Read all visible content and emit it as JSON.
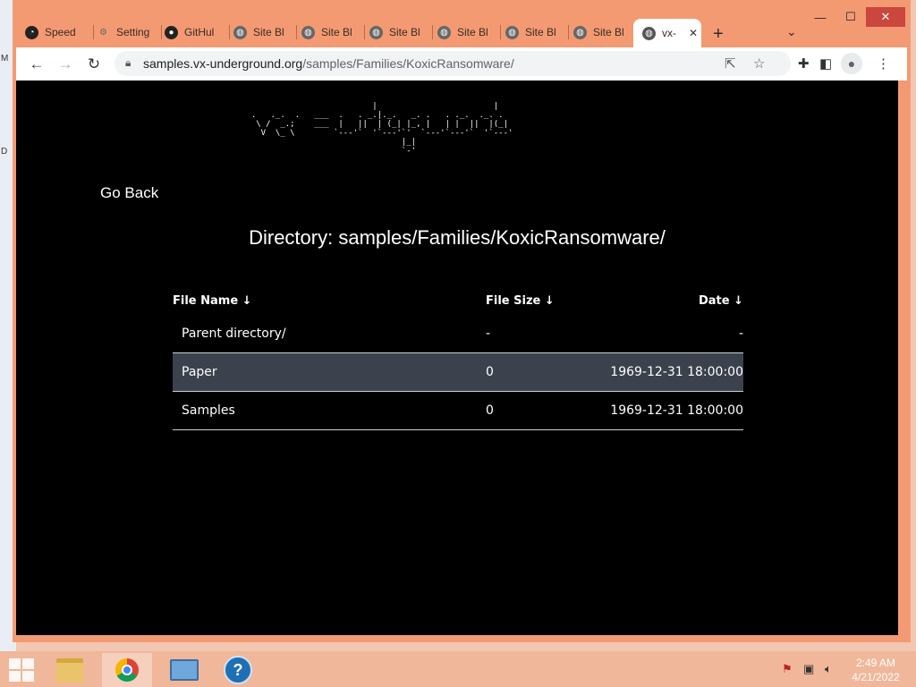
{
  "desktop": {
    "letter_top": "M",
    "letter_mid": "D"
  },
  "window_controls": {
    "minimize": "—",
    "maximize": "☐",
    "close": "✕"
  },
  "tabs": [
    {
      "label": "Speed",
      "icon": "speedometer-icon"
    },
    {
      "label": "Setting",
      "icon": "gear-icon"
    },
    {
      "label": "GitHul",
      "icon": "github-icon"
    },
    {
      "label": "Site Bl",
      "icon": "globe-icon"
    },
    {
      "label": "Site Bl",
      "icon": "globe-icon"
    },
    {
      "label": "Site Bl",
      "icon": "globe-icon"
    },
    {
      "label": "Site Bl",
      "icon": "globe-icon"
    },
    {
      "label": "Site Bl",
      "icon": "globe-icon"
    },
    {
      "label": "Site Bl",
      "icon": "globe-icon"
    },
    {
      "label": "vx-",
      "icon": "globe-icon",
      "active": true
    }
  ],
  "tab_close": "✕",
  "new_tab": "+",
  "tab_list": "⌄",
  "toolbar": {
    "back": "←",
    "forward": "→",
    "reload": "↻",
    "url_host": "samples.vx-underground.org",
    "url_path": "/samples/Families/KoxicRansomware/"
  },
  "page": {
    "logo_ascii": "                           |                        |\n  .   ._.  .   ___  .   . _.|._.   _. .   . ._.  ._. .\n   \\ /  _.;    ___  |   ||  | (_| |_, |   | |  ||  |(_|\n    V  \\_ \\        `---'`  '`---'`'  `---'`---'`  '`---'\n                                 |_|\n                                 `-'",
    "go_back": "Go Back",
    "directory_label": "Directory: samples/Families/KoxicRansomware/",
    "table": {
      "headers": {
        "name": "File Name  ↓",
        "size": "File Size  ↓",
        "date": "Date  ↓"
      },
      "rows": [
        {
          "name": "Parent directory/",
          "size": "-",
          "date": "-"
        },
        {
          "name": "Paper",
          "size": "0",
          "date": "1969-12-31 18:00:00"
        },
        {
          "name": "Samples",
          "size": "0",
          "date": "1969-12-31 18:00:00"
        }
      ]
    }
  },
  "taskbar": {
    "apps": [
      "file-explorer-icon",
      "chrome-icon",
      "control-panel-icon",
      "help-icon"
    ],
    "help_label": "?",
    "clock_time": "2:49 AM",
    "clock_date": "4/21/2022"
  },
  "colors": {
    "tab_strip": "#f39a73",
    "page_bg": "#000000",
    "row_highlight": "#3b414d",
    "taskbar": "#f1b79a"
  }
}
